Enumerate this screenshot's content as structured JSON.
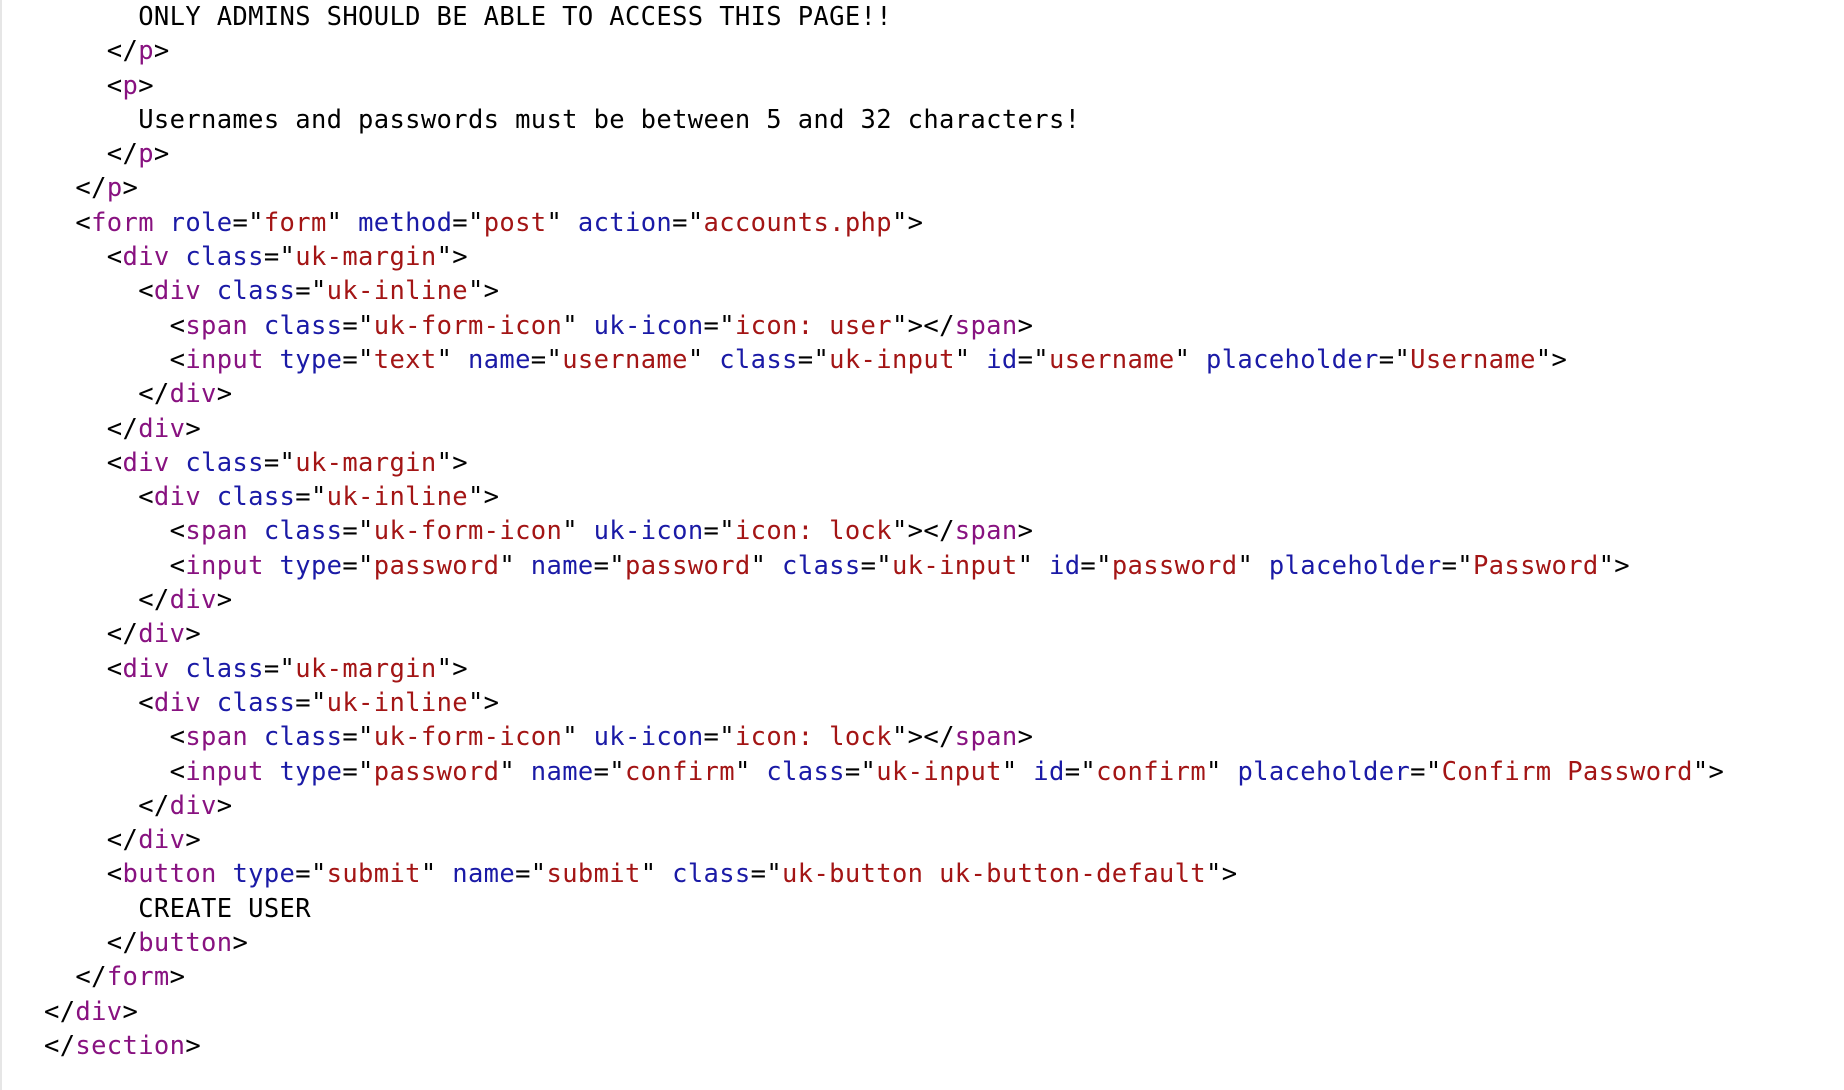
{
  "lines": [
    [
      {
        "t": "text",
        "v": "      ONLY ADMINS SHOULD BE ABLE TO ACCESS THIS PAGE!!"
      }
    ],
    [
      {
        "t": "punct",
        "v": "    </"
      },
      {
        "t": "tag",
        "v": "p"
      },
      {
        "t": "punct",
        "v": ">"
      }
    ],
    [
      {
        "t": "punct",
        "v": "    <"
      },
      {
        "t": "tag",
        "v": "p"
      },
      {
        "t": "punct",
        "v": ">"
      }
    ],
    [
      {
        "t": "text",
        "v": "      Usernames and passwords must be between 5 and 32 characters!"
      }
    ],
    [
      {
        "t": "punct",
        "v": "    </"
      },
      {
        "t": "tag",
        "v": "p"
      },
      {
        "t": "punct",
        "v": ">"
      }
    ],
    [
      {
        "t": "punct",
        "v": "  </"
      },
      {
        "t": "tag",
        "v": "p"
      },
      {
        "t": "punct",
        "v": ">"
      }
    ],
    [
      {
        "t": "punct",
        "v": "  <"
      },
      {
        "t": "tag",
        "v": "form"
      },
      {
        "t": "punct",
        "v": " "
      },
      {
        "t": "attr",
        "v": "role"
      },
      {
        "t": "punct",
        "v": "=\""
      },
      {
        "t": "val",
        "v": "form"
      },
      {
        "t": "punct",
        "v": "\" "
      },
      {
        "t": "attr",
        "v": "method"
      },
      {
        "t": "punct",
        "v": "=\""
      },
      {
        "t": "val",
        "v": "post"
      },
      {
        "t": "punct",
        "v": "\" "
      },
      {
        "t": "attr",
        "v": "action"
      },
      {
        "t": "punct",
        "v": "=\""
      },
      {
        "t": "val",
        "v": "accounts.php"
      },
      {
        "t": "punct",
        "v": "\">"
      }
    ],
    [
      {
        "t": "punct",
        "v": "    <"
      },
      {
        "t": "tag",
        "v": "div"
      },
      {
        "t": "punct",
        "v": " "
      },
      {
        "t": "attr",
        "v": "class"
      },
      {
        "t": "punct",
        "v": "=\""
      },
      {
        "t": "val",
        "v": "uk-margin"
      },
      {
        "t": "punct",
        "v": "\">"
      }
    ],
    [
      {
        "t": "punct",
        "v": "      <"
      },
      {
        "t": "tag",
        "v": "div"
      },
      {
        "t": "punct",
        "v": " "
      },
      {
        "t": "attr",
        "v": "class"
      },
      {
        "t": "punct",
        "v": "=\""
      },
      {
        "t": "val",
        "v": "uk-inline"
      },
      {
        "t": "punct",
        "v": "\">"
      }
    ],
    [
      {
        "t": "punct",
        "v": "        <"
      },
      {
        "t": "tag",
        "v": "span"
      },
      {
        "t": "punct",
        "v": " "
      },
      {
        "t": "attr",
        "v": "class"
      },
      {
        "t": "punct",
        "v": "=\""
      },
      {
        "t": "val",
        "v": "uk-form-icon"
      },
      {
        "t": "punct",
        "v": "\" "
      },
      {
        "t": "attr",
        "v": "uk-icon"
      },
      {
        "t": "punct",
        "v": "=\""
      },
      {
        "t": "val",
        "v": "icon: user"
      },
      {
        "t": "punct",
        "v": "\"></"
      },
      {
        "t": "tag",
        "v": "span"
      },
      {
        "t": "punct",
        "v": ">"
      }
    ],
    [
      {
        "t": "punct",
        "v": "        <"
      },
      {
        "t": "tag",
        "v": "input"
      },
      {
        "t": "punct",
        "v": " "
      },
      {
        "t": "attr",
        "v": "type"
      },
      {
        "t": "punct",
        "v": "=\""
      },
      {
        "t": "val",
        "v": "text"
      },
      {
        "t": "punct",
        "v": "\" "
      },
      {
        "t": "attr",
        "v": "name"
      },
      {
        "t": "punct",
        "v": "=\""
      },
      {
        "t": "val",
        "v": "username"
      },
      {
        "t": "punct",
        "v": "\" "
      },
      {
        "t": "attr",
        "v": "class"
      },
      {
        "t": "punct",
        "v": "=\""
      },
      {
        "t": "val",
        "v": "uk-input"
      },
      {
        "t": "punct",
        "v": "\" "
      },
      {
        "t": "attr",
        "v": "id"
      },
      {
        "t": "punct",
        "v": "=\""
      },
      {
        "t": "val",
        "v": "username"
      },
      {
        "t": "punct",
        "v": "\" "
      },
      {
        "t": "attr",
        "v": "placeholder"
      },
      {
        "t": "punct",
        "v": "=\""
      },
      {
        "t": "val",
        "v": "Username"
      },
      {
        "t": "punct",
        "v": "\">"
      }
    ],
    [
      {
        "t": "punct",
        "v": "      </"
      },
      {
        "t": "tag",
        "v": "div"
      },
      {
        "t": "punct",
        "v": ">"
      }
    ],
    [
      {
        "t": "punct",
        "v": "    </"
      },
      {
        "t": "tag",
        "v": "div"
      },
      {
        "t": "punct",
        "v": ">"
      }
    ],
    [
      {
        "t": "punct",
        "v": "    <"
      },
      {
        "t": "tag",
        "v": "div"
      },
      {
        "t": "punct",
        "v": " "
      },
      {
        "t": "attr",
        "v": "class"
      },
      {
        "t": "punct",
        "v": "=\""
      },
      {
        "t": "val",
        "v": "uk-margin"
      },
      {
        "t": "punct",
        "v": "\">"
      }
    ],
    [
      {
        "t": "punct",
        "v": "      <"
      },
      {
        "t": "tag",
        "v": "div"
      },
      {
        "t": "punct",
        "v": " "
      },
      {
        "t": "attr",
        "v": "class"
      },
      {
        "t": "punct",
        "v": "=\""
      },
      {
        "t": "val",
        "v": "uk-inline"
      },
      {
        "t": "punct",
        "v": "\">"
      }
    ],
    [
      {
        "t": "punct",
        "v": "        <"
      },
      {
        "t": "tag",
        "v": "span"
      },
      {
        "t": "punct",
        "v": " "
      },
      {
        "t": "attr",
        "v": "class"
      },
      {
        "t": "punct",
        "v": "=\""
      },
      {
        "t": "val",
        "v": "uk-form-icon"
      },
      {
        "t": "punct",
        "v": "\" "
      },
      {
        "t": "attr",
        "v": "uk-icon"
      },
      {
        "t": "punct",
        "v": "=\""
      },
      {
        "t": "val",
        "v": "icon: lock"
      },
      {
        "t": "punct",
        "v": "\"></"
      },
      {
        "t": "tag",
        "v": "span"
      },
      {
        "t": "punct",
        "v": ">"
      }
    ],
    [
      {
        "t": "punct",
        "v": "        <"
      },
      {
        "t": "tag",
        "v": "input"
      },
      {
        "t": "punct",
        "v": " "
      },
      {
        "t": "attr",
        "v": "type"
      },
      {
        "t": "punct",
        "v": "=\""
      },
      {
        "t": "val",
        "v": "password"
      },
      {
        "t": "punct",
        "v": "\" "
      },
      {
        "t": "attr",
        "v": "name"
      },
      {
        "t": "punct",
        "v": "=\""
      },
      {
        "t": "val",
        "v": "password"
      },
      {
        "t": "punct",
        "v": "\" "
      },
      {
        "t": "attr",
        "v": "class"
      },
      {
        "t": "punct",
        "v": "=\""
      },
      {
        "t": "val",
        "v": "uk-input"
      },
      {
        "t": "punct",
        "v": "\" "
      },
      {
        "t": "attr",
        "v": "id"
      },
      {
        "t": "punct",
        "v": "=\""
      },
      {
        "t": "val",
        "v": "password"
      },
      {
        "t": "punct",
        "v": "\" "
      },
      {
        "t": "attr",
        "v": "placeholder"
      },
      {
        "t": "punct",
        "v": "=\""
      },
      {
        "t": "val",
        "v": "Password"
      },
      {
        "t": "punct",
        "v": "\">"
      }
    ],
    [
      {
        "t": "punct",
        "v": "      </"
      },
      {
        "t": "tag",
        "v": "div"
      },
      {
        "t": "punct",
        "v": ">"
      }
    ],
    [
      {
        "t": "punct",
        "v": "    </"
      },
      {
        "t": "tag",
        "v": "div"
      },
      {
        "t": "punct",
        "v": ">"
      }
    ],
    [
      {
        "t": "punct",
        "v": "    <"
      },
      {
        "t": "tag",
        "v": "div"
      },
      {
        "t": "punct",
        "v": " "
      },
      {
        "t": "attr",
        "v": "class"
      },
      {
        "t": "punct",
        "v": "=\""
      },
      {
        "t": "val",
        "v": "uk-margin"
      },
      {
        "t": "punct",
        "v": "\">"
      }
    ],
    [
      {
        "t": "punct",
        "v": "      <"
      },
      {
        "t": "tag",
        "v": "div"
      },
      {
        "t": "punct",
        "v": " "
      },
      {
        "t": "attr",
        "v": "class"
      },
      {
        "t": "punct",
        "v": "=\""
      },
      {
        "t": "val",
        "v": "uk-inline"
      },
      {
        "t": "punct",
        "v": "\">"
      }
    ],
    [
      {
        "t": "punct",
        "v": "        <"
      },
      {
        "t": "tag",
        "v": "span"
      },
      {
        "t": "punct",
        "v": " "
      },
      {
        "t": "attr",
        "v": "class"
      },
      {
        "t": "punct",
        "v": "=\""
      },
      {
        "t": "val",
        "v": "uk-form-icon"
      },
      {
        "t": "punct",
        "v": "\" "
      },
      {
        "t": "attr",
        "v": "uk-icon"
      },
      {
        "t": "punct",
        "v": "=\""
      },
      {
        "t": "val",
        "v": "icon: lock"
      },
      {
        "t": "punct",
        "v": "\"></"
      },
      {
        "t": "tag",
        "v": "span"
      },
      {
        "t": "punct",
        "v": ">"
      }
    ],
    [
      {
        "t": "punct",
        "v": "        <"
      },
      {
        "t": "tag",
        "v": "input"
      },
      {
        "t": "punct",
        "v": " "
      },
      {
        "t": "attr",
        "v": "type"
      },
      {
        "t": "punct",
        "v": "=\""
      },
      {
        "t": "val",
        "v": "password"
      },
      {
        "t": "punct",
        "v": "\" "
      },
      {
        "t": "attr",
        "v": "name"
      },
      {
        "t": "punct",
        "v": "=\""
      },
      {
        "t": "val",
        "v": "confirm"
      },
      {
        "t": "punct",
        "v": "\" "
      },
      {
        "t": "attr",
        "v": "class"
      },
      {
        "t": "punct",
        "v": "=\""
      },
      {
        "t": "val",
        "v": "uk-input"
      },
      {
        "t": "punct",
        "v": "\" "
      },
      {
        "t": "attr",
        "v": "id"
      },
      {
        "t": "punct",
        "v": "=\""
      },
      {
        "t": "val",
        "v": "confirm"
      },
      {
        "t": "punct",
        "v": "\" "
      },
      {
        "t": "attr",
        "v": "placeholder"
      },
      {
        "t": "punct",
        "v": "=\""
      },
      {
        "t": "val",
        "v": "Confirm Password"
      },
      {
        "t": "punct",
        "v": "\">"
      }
    ],
    [
      {
        "t": "punct",
        "v": "      </"
      },
      {
        "t": "tag",
        "v": "div"
      },
      {
        "t": "punct",
        "v": ">"
      }
    ],
    [
      {
        "t": "punct",
        "v": "    </"
      },
      {
        "t": "tag",
        "v": "div"
      },
      {
        "t": "punct",
        "v": ">"
      }
    ],
    [
      {
        "t": "punct",
        "v": "    <"
      },
      {
        "t": "tag",
        "v": "button"
      },
      {
        "t": "punct",
        "v": " "
      },
      {
        "t": "attr",
        "v": "type"
      },
      {
        "t": "punct",
        "v": "=\""
      },
      {
        "t": "val",
        "v": "submit"
      },
      {
        "t": "punct",
        "v": "\" "
      },
      {
        "t": "attr",
        "v": "name"
      },
      {
        "t": "punct",
        "v": "=\""
      },
      {
        "t": "val",
        "v": "submit"
      },
      {
        "t": "punct",
        "v": "\" "
      },
      {
        "t": "attr",
        "v": "class"
      },
      {
        "t": "punct",
        "v": "=\""
      },
      {
        "t": "val",
        "v": "uk-button uk-button-default"
      },
      {
        "t": "punct",
        "v": "\">"
      }
    ],
    [
      {
        "t": "text",
        "v": "      CREATE USER"
      }
    ],
    [
      {
        "t": "punct",
        "v": "    </"
      },
      {
        "t": "tag",
        "v": "button"
      },
      {
        "t": "punct",
        "v": ">"
      }
    ],
    [
      {
        "t": "punct",
        "v": "  </"
      },
      {
        "t": "tag",
        "v": "form"
      },
      {
        "t": "punct",
        "v": ">"
      }
    ],
    [
      {
        "t": "punct",
        "v": "</"
      },
      {
        "t": "tag",
        "v": "div"
      },
      {
        "t": "punct",
        "v": ">"
      }
    ],
    [
      {
        "t": "punct",
        "v": "</"
      },
      {
        "t": "tag",
        "v": "section"
      },
      {
        "t": "punct",
        "v": ">"
      }
    ]
  ],
  "colors": {
    "background": "#ffffff",
    "tag": "#881280",
    "attribute": "#1a1aa6",
    "value": "#a31515",
    "text": "#000000",
    "gutter_border": "#e6e6e6"
  }
}
